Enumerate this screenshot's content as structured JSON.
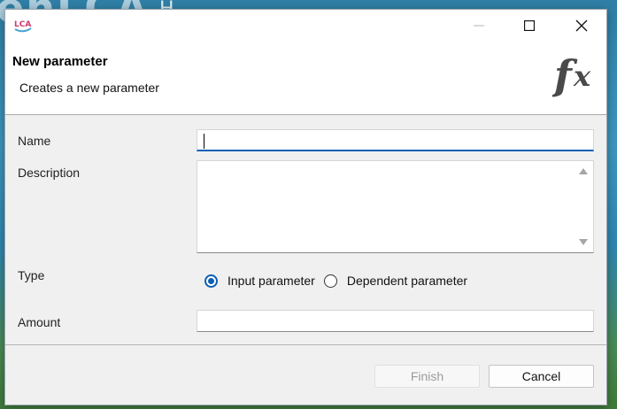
{
  "window": {
    "minimize_icon": "minimize-icon",
    "maximize_icon": "maximize-icon",
    "close_icon": "close-icon"
  },
  "header": {
    "title": "New parameter",
    "subtitle": "Creates a new parameter",
    "icon": "fx-icon"
  },
  "form": {
    "name_label": "Name",
    "name_value": "",
    "description_label": "Description",
    "description_value": "",
    "type_label": "Type",
    "type_options": [
      {
        "label": "Input parameter",
        "selected": true
      },
      {
        "label": "Dependent parameter",
        "selected": false
      }
    ],
    "amount_label": "Amount",
    "amount_value": ""
  },
  "buttons": {
    "finish": "Finish",
    "cancel": "Cancel"
  },
  "colors": {
    "accent": "#0a5fb4",
    "dialog_bg": "#f0f0f0"
  }
}
